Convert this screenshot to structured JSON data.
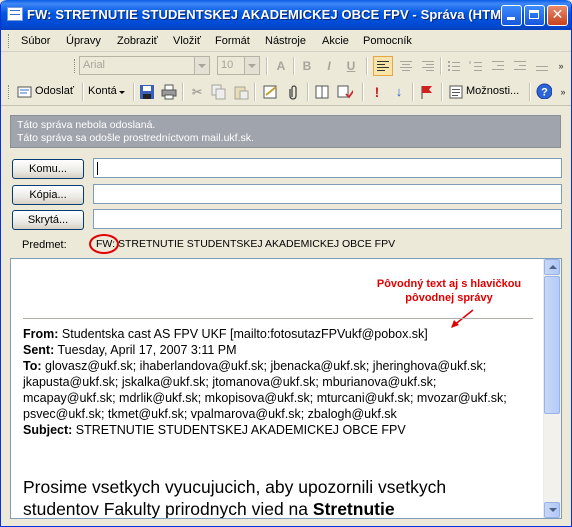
{
  "window": {
    "title": "FW: STRETNUTIE STUDENTSKEJ AKADEMICKEJ OBCE FPV - Správa (HTML)",
    "accent": "#0054E3"
  },
  "menu": {
    "items": [
      "Súbor",
      "Úpravy",
      "Zobraziť",
      "Vložiť",
      "Formát",
      "Nástroje",
      "Akcie",
      "Pomocník"
    ]
  },
  "format_toolbar": {
    "font_value": "Arial",
    "size_value": "10",
    "icons": [
      "font-color-icon",
      "bold-icon",
      "italic-icon",
      "underline-icon",
      "align-left-icon",
      "center-icon",
      "align-right-icon",
      "bullets-icon",
      "numbering-icon",
      "decrease-indent-icon",
      "increase-indent-icon",
      "horizontal-line-icon"
    ]
  },
  "standard_toolbar": {
    "send_label": "Odoslať",
    "accounts_label": "Kontá",
    "options_label": "Možnosti...",
    "icons": [
      "save-icon",
      "print-icon",
      "cut-icon",
      "copy-icon",
      "paste-icon",
      "signature-icon",
      "attach-icon",
      "address-book-icon",
      "check-names-icon",
      "importance-high-icon",
      "importance-low-icon",
      "flag-icon",
      "help-icon"
    ]
  },
  "infobar": {
    "line1": "Táto správa nebola odoslaná.",
    "line2": "Táto správa sa odošle prostredníctvom mail.ukf.sk."
  },
  "address": {
    "to_button": "Komu...",
    "cc_button": "Kópia...",
    "bcc_button": "Skrytá...",
    "subject_label": "Predmet:",
    "subject_value": "FW: STRETNUTIE STUDENTSKEJ AKADEMICKEJ OBCE FPV"
  },
  "annotation": {
    "line1": "Pôvodný text aj s hlavičkou",
    "line2": "pôvodnej správy"
  },
  "message": {
    "from_label": "From:",
    "from_value": "Studentska cast AS FPV UKF [mailto:fotosutazFPVukf@pobox.sk]",
    "sent_label": "Sent:",
    "sent_value": "Tuesday, April 17, 2007 3:11 PM",
    "to_label": "To:",
    "to_line1": "glovasz@ukf.sk; ihaberlandova@ukf.sk; jbenacka@ukf.sk; jheringhova@ukf.sk;",
    "to_line2": "jkapusta@ukf.sk; jskalka@ukf.sk; jtomanova@ukf.sk; mburianova@ukf.sk;",
    "to_line3": "mcapay@ukf.sk; mdrlik@ukf.sk; mkopisova@ukf.sk; mturcani@ukf.sk; mvozar@ukf.sk;",
    "to_line4": "psvec@ukf.sk; tkmet@ukf.sk; vpalmarova@ukf.sk; zbalogh@ukf.sk",
    "subject_label": "Subject:",
    "subject_value": "STRETNUTIE STUDENTSKEJ AKADEMICKEJ OBCE FPV",
    "body_line1": "Prosime vsetkych vyucujucich, aby upozornili vsetkych",
    "body_line2a": "studentov Fakulty prirodnych vied na ",
    "body_line2b": "Stretnutie"
  }
}
